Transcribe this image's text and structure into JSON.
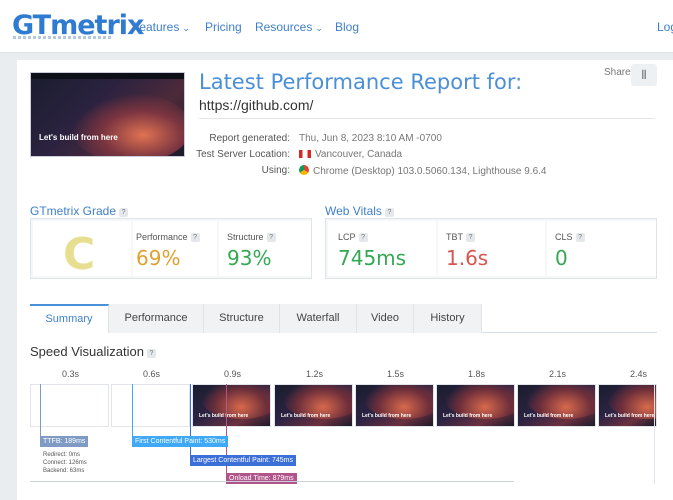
{
  "nav": {
    "logo": "GTmetrix",
    "items": [
      {
        "label": "Features",
        "has_caret": true
      },
      {
        "label": "Pricing",
        "has_caret": false
      },
      {
        "label": "Resources",
        "has_caret": true
      },
      {
        "label": "Blog",
        "has_caret": false
      }
    ],
    "login": "Log"
  },
  "report": {
    "title": "Latest Performance Report for:",
    "url": "https://github.com/",
    "share_label": "Share",
    "thumbnail_text": "Let's build from here",
    "meta": [
      {
        "key": "Report generated:",
        "value": "Thu, Jun 8, 2023 8:10 AM -0700"
      },
      {
        "key": "Test Server Location:",
        "value": "Vancouver, Canada"
      },
      {
        "key": "Using:",
        "value": "Chrome (Desktop) 103.0.5060.134, Lighthouse 9.6.4"
      }
    ]
  },
  "grade": {
    "title": "GTmetrix Grade",
    "letter": "C",
    "performance_label": "Performance",
    "performance_value": "69%",
    "structure_label": "Structure",
    "structure_value": "93%"
  },
  "vitals": {
    "title": "Web Vitals",
    "lcp_label": "LCP",
    "lcp_value": "745ms",
    "tbt_label": "TBT",
    "tbt_value": "1.6s",
    "cls_label": "CLS",
    "cls_value": "0"
  },
  "tabs": [
    "Summary",
    "Performance",
    "Structure",
    "Waterfall",
    "Video",
    "History"
  ],
  "active_tab": "Summary",
  "speed": {
    "title": "Speed Visualization",
    "ticks": [
      "0.3s",
      "0.6s",
      "0.9s",
      "1.2s",
      "1.5s",
      "1.8s",
      "2.1s",
      "2.4s"
    ],
    "frame_text": "Let's build from here",
    "ttfb": "TTFB: 189ms",
    "ttfb_details": [
      "Redirect: 0ms",
      "Connect: 126ms",
      "Backend: 63ms"
    ],
    "fcp": "First Contentful Paint: 530ms",
    "lcp": "Largest Contentful Paint: 745ms",
    "onload": "Onload Time: 879ms"
  },
  "colors": {
    "brand": "#4a8fd8",
    "grade_c": "#e6df91",
    "good": "#34a853",
    "warn": "#e0a030",
    "bad": "#d9534f",
    "ttfb": "#7f9bc4",
    "fcp": "#3fa9f5",
    "lcp": "#3d6fd8",
    "onload": "#b0548a"
  }
}
